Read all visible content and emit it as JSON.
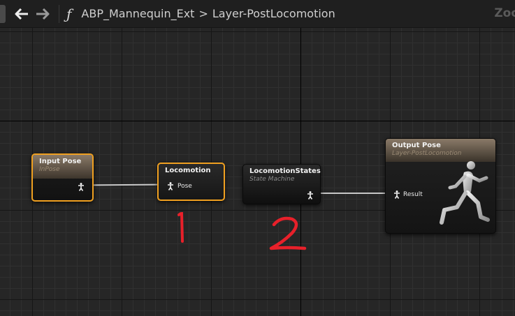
{
  "toolbar": {
    "back_icon": "arrow-left-icon",
    "forward_icon": "arrow-right-icon",
    "function_icon": "function-icon",
    "breadcrumb_parent": "ABP_Mannequin_Ext",
    "breadcrumb_separator": ">",
    "breadcrumb_current": "Layer-PostLocomotion",
    "zoom_text": "Zoo"
  },
  "nodes": {
    "input_pose": {
      "title": "Input Pose",
      "subtitle": "InPose"
    },
    "locomotion": {
      "title": "Locomotion",
      "pin_label": "Pose"
    },
    "locomotion_states": {
      "title": "LocomotionStates",
      "subtitle": "State Machine"
    },
    "output_pose": {
      "title": "Output Pose",
      "subtitle": "Layer-PostLocomotion",
      "pin_label": "Result"
    }
  },
  "annotations": {
    "one": "1",
    "two": "2"
  },
  "colors": {
    "selection": "#f0a020",
    "annotation": "#e8202a",
    "wire": "#c8c8c8"
  }
}
